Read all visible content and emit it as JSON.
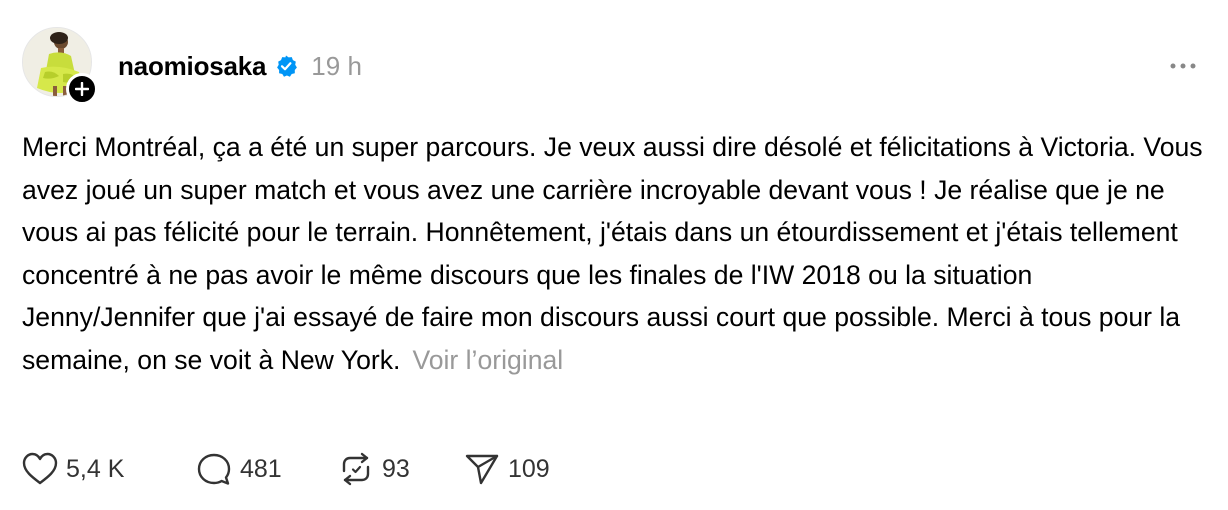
{
  "post": {
    "username": "naomiosaka",
    "verified": true,
    "time": "19 h",
    "text": "Merci Montréal, ça a été un super parcours. Je veux aussi dire désolé et félicitations à Victoria. Vous avez joué un super match et vous avez une carrière incroyable devant vous ! Je réalise que je ne vous ai pas félicité pour le terrain. Honnêtement, j'étais dans un étourdissement et j'étais tellement concentré à ne pas avoir le même discours que les finales de l'IW 2018 ou la situation Jenny/Jennifer que j'ai essayé de faire mon discours aussi court que possible. Merci à tous pour la semaine, on se voit à New York.",
    "translate_link": "Voir l’original"
  },
  "actions": {
    "likes": "5,4 K",
    "replies": "481",
    "reposts": "93",
    "shares": "109"
  },
  "icons": {
    "verified": "verified-badge-icon",
    "follow": "plus-icon",
    "more": "more-horizontal-icon",
    "like": "heart-icon",
    "reply": "comment-icon",
    "repost": "repost-icon",
    "share": "send-icon"
  },
  "colors": {
    "verified_blue": "#0095F6",
    "muted_text": "#999999",
    "text": "#000000"
  }
}
